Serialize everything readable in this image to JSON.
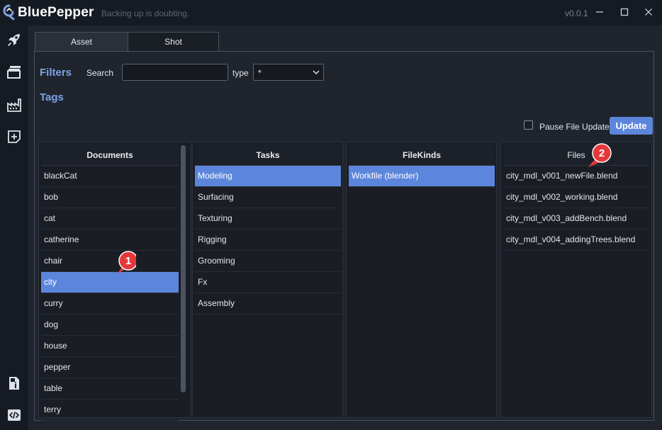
{
  "app": {
    "name": "BluePepper",
    "tagline": "Backing up is doubting.",
    "version": "v0.0.1"
  },
  "window_controls": [
    "minimize-icon",
    "maximize-icon",
    "close-icon"
  ],
  "sidebar": {
    "top_icons": [
      "rocket-icon",
      "stack-icon",
      "factory-icon",
      "add-document-icon"
    ],
    "bottom_icons": [
      "file-info-icon",
      "code-icon"
    ]
  },
  "tabs": [
    {
      "label": "Asset",
      "active": true
    },
    {
      "label": "Shot",
      "active": false
    }
  ],
  "filters": {
    "title": "Filters",
    "search_label": "Search",
    "search_value": "",
    "type_label": "type",
    "type_value": "*"
  },
  "tags": {
    "title": "Tags"
  },
  "pause_file_update": {
    "label": "Pause File Update",
    "checked": false
  },
  "update_button": "Update",
  "columns": {
    "documents": {
      "header": "Documents",
      "items": [
        "blackCat",
        "bob",
        "cat",
        "catherine",
        "chair",
        "city",
        "curry",
        "dog",
        "house",
        "pepper",
        "table",
        "terry"
      ],
      "selected": "city"
    },
    "tasks": {
      "header": "Tasks",
      "items": [
        "Modeling",
        "Surfacing",
        "Texturing",
        "Rigging",
        "Grooming",
        "Fx",
        "Assembly"
      ],
      "selected": "Modeling"
    },
    "filekinds": {
      "header": "FileKinds",
      "items": [
        "Workfile (blender)"
      ],
      "selected": "Workfile (blender)"
    },
    "files": {
      "header": "Files",
      "items": [
        "city_mdl_v001_newFile.blend",
        "city_mdl_v002_working.blend",
        "city_mdl_v003_addBench.blend",
        "city_mdl_v004_addingTrees.blend"
      ]
    }
  },
  "markers": [
    "1",
    "2"
  ],
  "colors": {
    "accent": "#5c86db",
    "heading": "#7fa2e6",
    "marker": "#e5383b",
    "background": "#161b23",
    "panel": "#1f242d"
  }
}
